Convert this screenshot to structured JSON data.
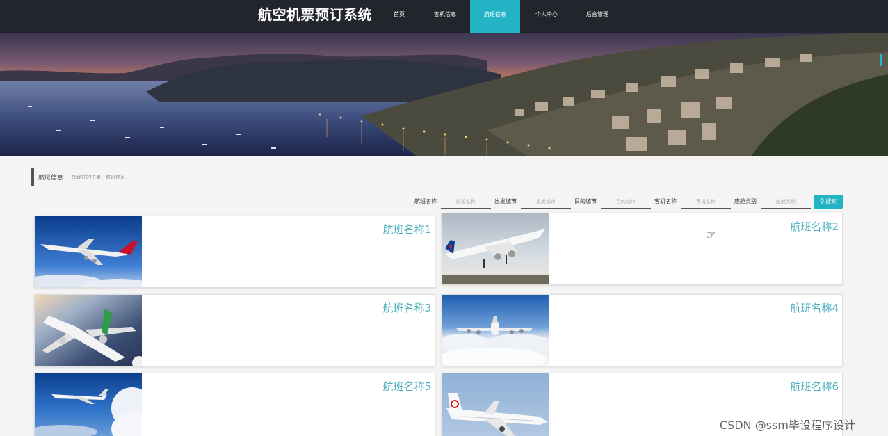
{
  "header": {
    "title": "航空机票预订系统",
    "nav": [
      {
        "label": "首页",
        "active": false
      },
      {
        "label": "客机信息",
        "active": false
      },
      {
        "label": "航班信息",
        "active": true
      },
      {
        "label": "个人中心",
        "active": false
      },
      {
        "label": "后台管理",
        "active": false
      }
    ]
  },
  "breadcrumb": {
    "title": "航班信息",
    "path": "您现在的位置：航班信息"
  },
  "search": {
    "fields": [
      {
        "label": "航班名称",
        "placeholder": "航班名称"
      },
      {
        "label": "出发城市",
        "placeholder": "出发城市"
      },
      {
        "label": "目的城市",
        "placeholder": "目的城市"
      },
      {
        "label": "客机名称",
        "placeholder": "客机名称"
      },
      {
        "label": "座舱类别",
        "placeholder": "座舱类别"
      }
    ],
    "button_label": "搜索",
    "button_icon": "search-icon"
  },
  "flights": [
    {
      "name": "航班名称1",
      "image": "airplane-qantas"
    },
    {
      "name": "航班名称2",
      "image": "airplane-takeoff-airfrance"
    },
    {
      "name": "航班名称3",
      "image": "airplane-green-tail"
    },
    {
      "name": "航班名称4",
      "image": "airplane-over-clouds"
    },
    {
      "name": "航班名称5",
      "image": "airplane-blue-sky"
    },
    {
      "name": "航班名称6",
      "image": "airplane-air-china"
    }
  ],
  "watermark": "CSDN @ssm毕设程序设计",
  "colors": {
    "header_bg": "#23252d",
    "accent": "#22b3c4",
    "card_title": "#4fb1bf",
    "page_bg": "#f4f4f4"
  }
}
